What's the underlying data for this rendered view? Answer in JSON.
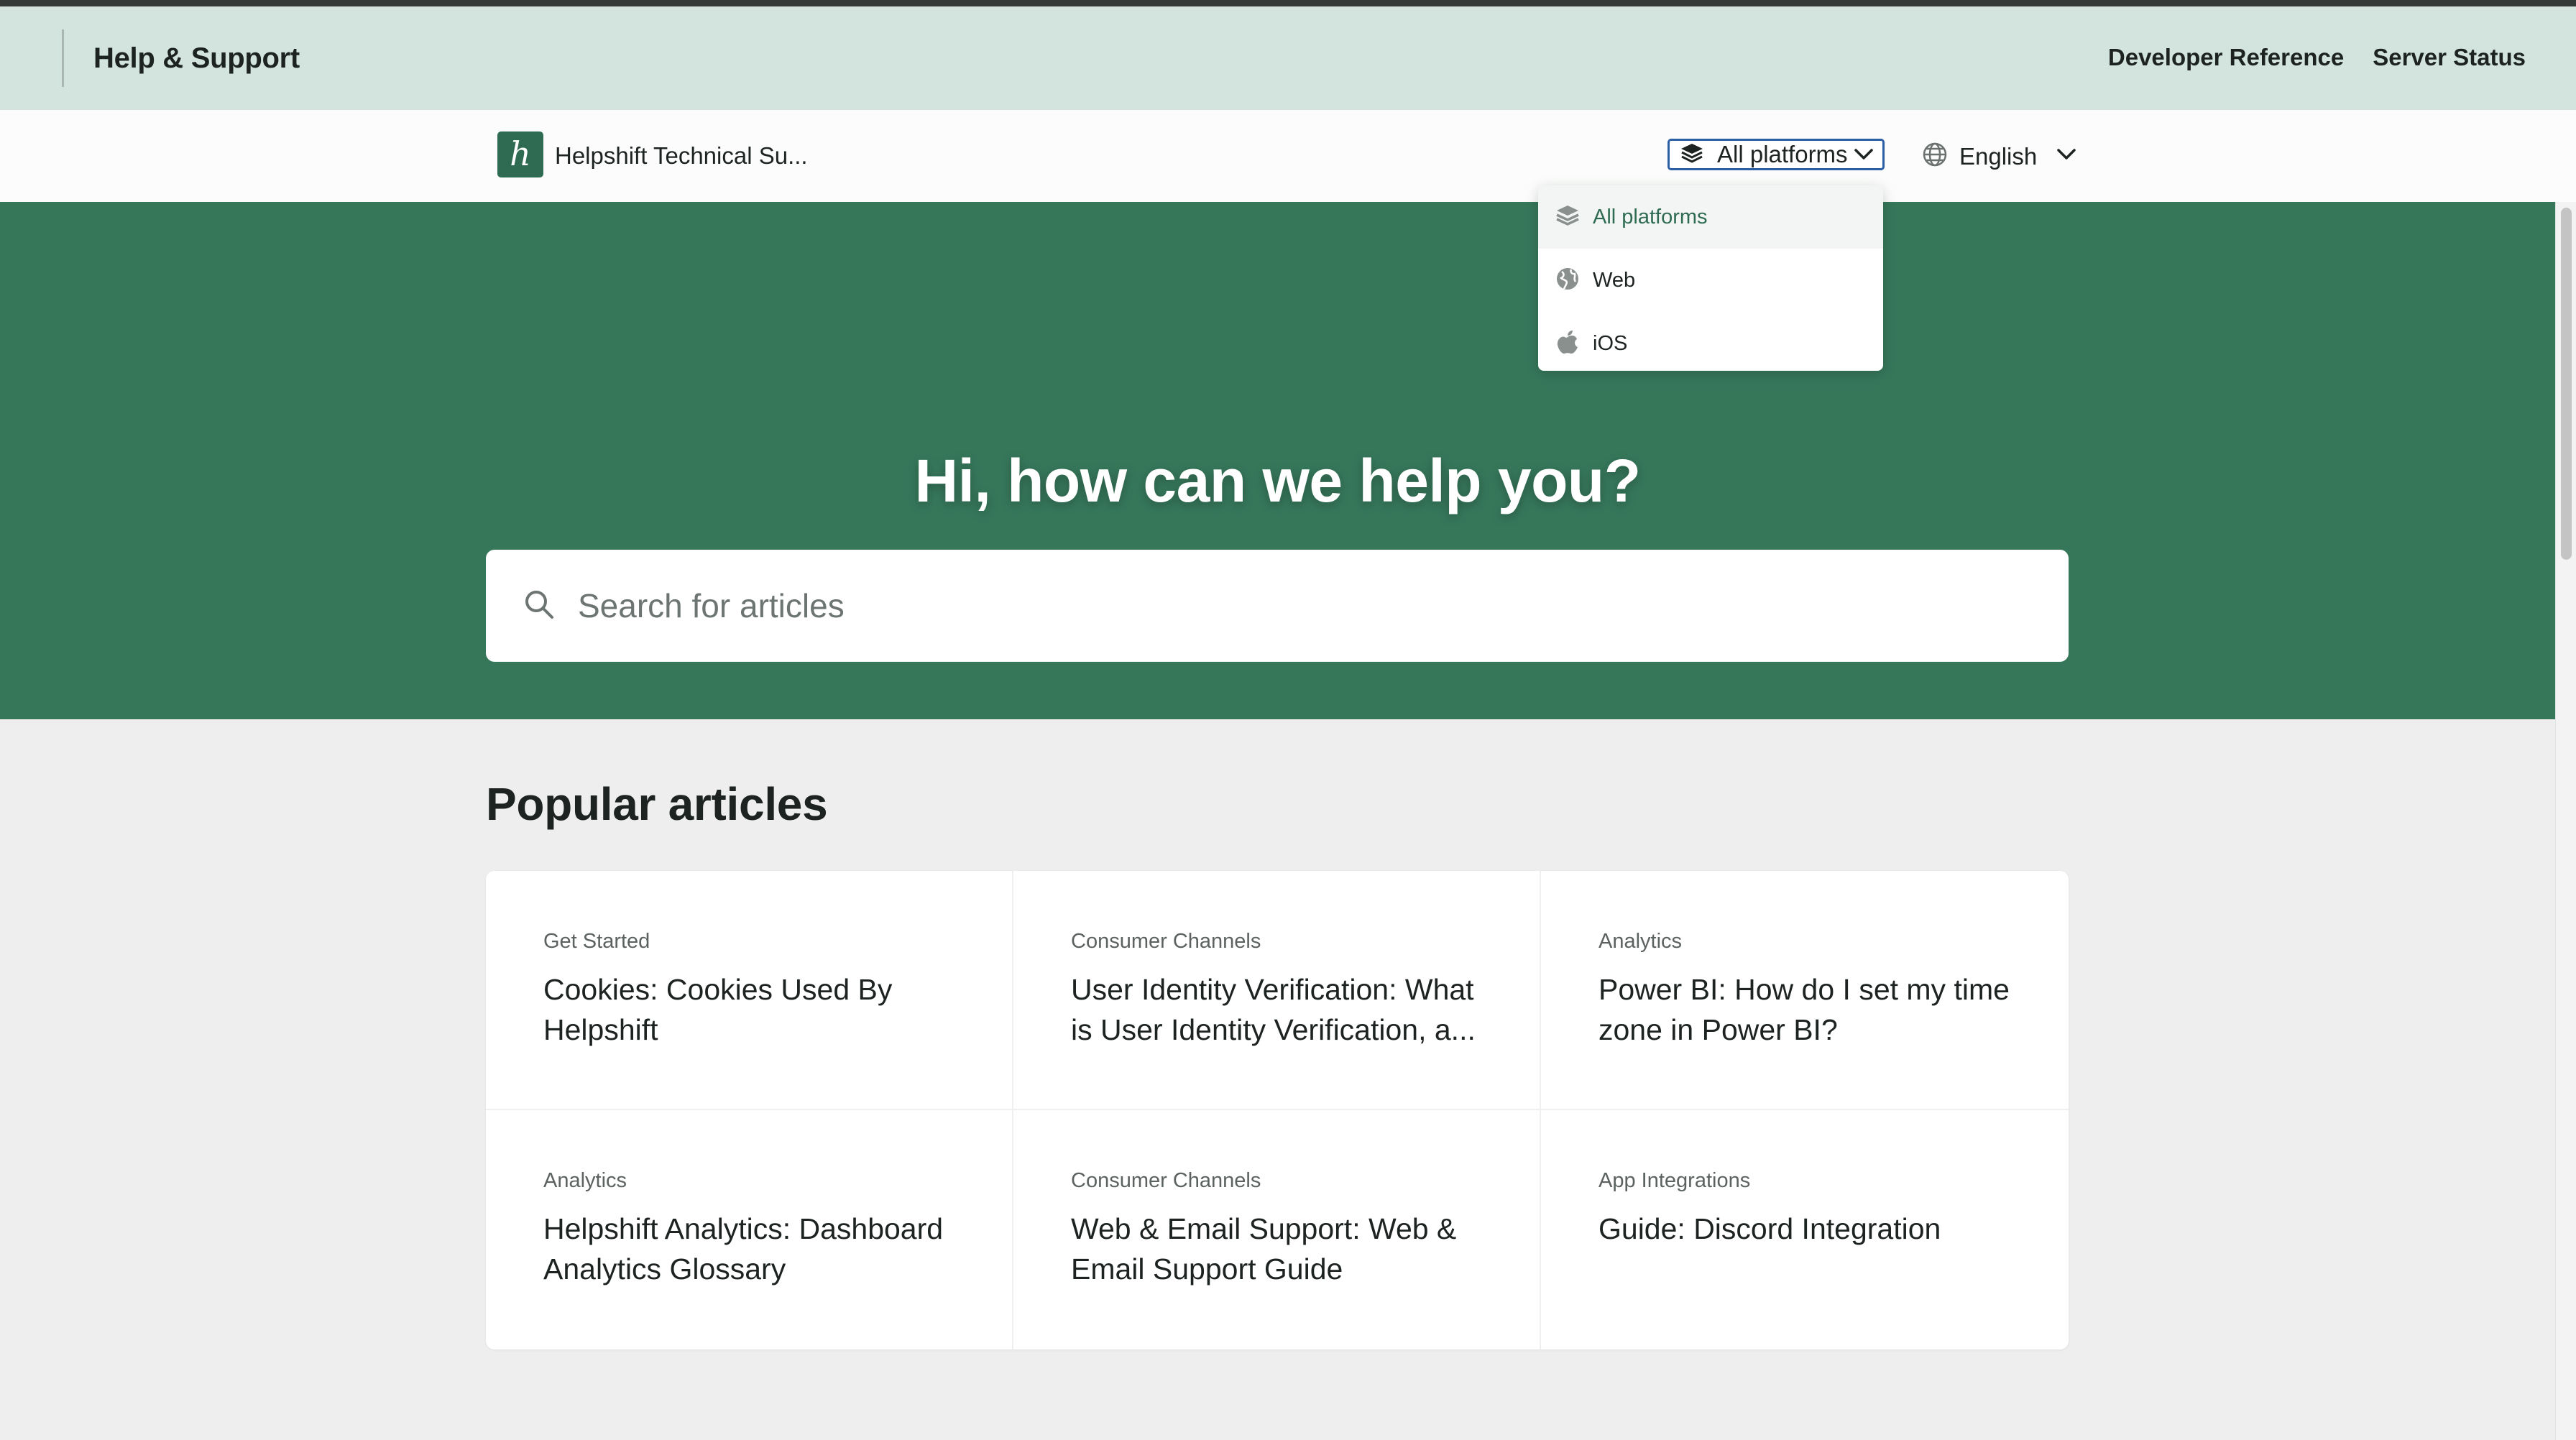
{
  "topbar": {
    "title": "Help & Support",
    "links": [
      "Developer Reference",
      "Server Status"
    ]
  },
  "subheader": {
    "logo_letter": "h",
    "site_name": "Helpshift Technical Su...",
    "platform_select": {
      "value": "All platforms",
      "icon": "layers-icon"
    },
    "language": {
      "value": "English",
      "icon": "globe-icon"
    }
  },
  "dropdown": {
    "items": [
      {
        "label": "All platforms",
        "icon": "layers-icon",
        "selected": true
      },
      {
        "label": "Web",
        "icon": "globe-icon",
        "selected": false
      },
      {
        "label": "iOS",
        "icon": "apple-icon",
        "selected": false
      }
    ]
  },
  "hero": {
    "heading": "Hi, how can we help you?",
    "search_placeholder": "Search for articles"
  },
  "popular": {
    "title": "Popular articles",
    "articles": [
      {
        "category": "Get Started",
        "title": "Cookies: Cookies Used By Helpshift"
      },
      {
        "category": "Consumer Channels",
        "title": "User Identity Verification: What is User Identity Verification, a..."
      },
      {
        "category": "Analytics",
        "title": "Power BI: How do I set my time zone in Power BI?"
      },
      {
        "category": "Analytics",
        "title": "Helpshift Analytics: Dashboard Analytics Glossary"
      },
      {
        "category": "Consumer Channels",
        "title": "Web & Email Support: Web & Email Support Guide"
      },
      {
        "category": "App Integrations",
        "title": "Guide: Discord Integration"
      }
    ]
  },
  "colors": {
    "topbar_bg": "#d3e4de",
    "hero_bg": "#36775a",
    "brand": "#2e6b52",
    "page_bg": "#edeeed",
    "focus_ring": "#2a5ea5"
  }
}
